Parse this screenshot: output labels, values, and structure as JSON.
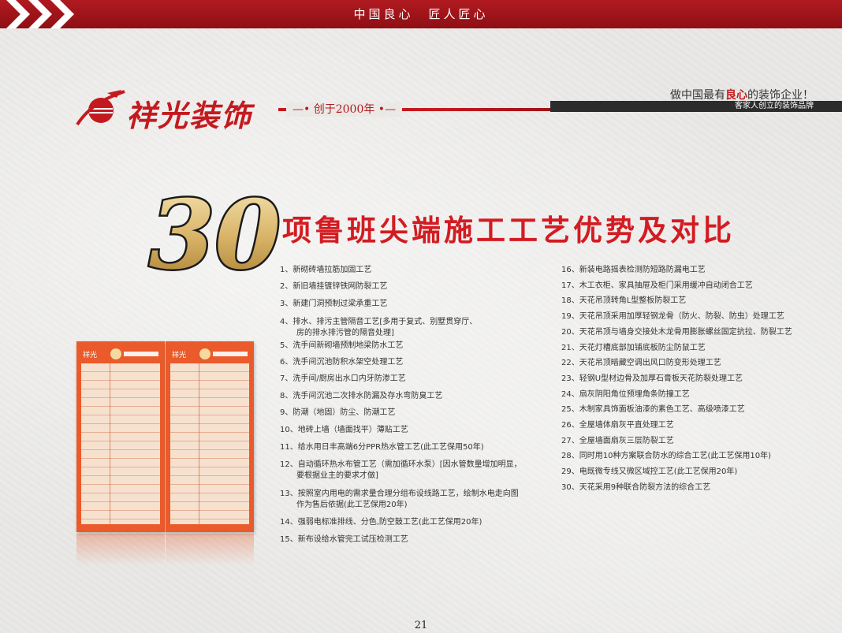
{
  "header": {
    "slogan_bar": "中国良心　匠人匠心"
  },
  "brand": {
    "name": "祥光装饰",
    "founded": "创于2000年",
    "slogan_pre": "做中国最有",
    "slogan_bold": "良心",
    "slogan_post": "的装饰企业！",
    "tagline": "客家人创立的装饰品牌"
  },
  "title": {
    "number": "30",
    "text": "项鲁班尖端施工工艺优势及对比"
  },
  "left_list": [
    {
      "line1": "1、新砌砖墙拉筋加固工艺"
    },
    {
      "line1": "2、新旧墙挂镀锌铁网防裂工艺"
    },
    {
      "line1": "3、新建门洞预制过梁承重工艺"
    },
    {
      "line1": "4、排水、排污主管隔音工艺[多用于复式、别墅贯穿厅、",
      "line2": "房的排水排污管的隔音处理]"
    },
    {
      "line1": "5、洗手间新砌墙预制地梁防水工艺"
    },
    {
      "line1": "6、洗手间沉池防积水架空处理工艺"
    },
    {
      "line1": "7、洗手间/厨房出水口内牙防渗工艺"
    },
    {
      "line1": "8、洗手间沉池二次排水防漏及存水弯防臭工艺"
    },
    {
      "line1": "9、防潮（地固）防尘、防潮工艺"
    },
    {
      "line1": "10、地砖上墙（墙面找平）薄贴工艺"
    },
    {
      "line1": "11、给水用日丰高端6分PPR热水管工艺(此工艺保用50年)"
    },
    {
      "line1": "12、自动循环热水布管工艺（需加循环水泵）[因水管数量增加明显，",
      "line2": "要根据业主的要求才做]"
    },
    {
      "line1": "13、按照室内用电的需求量合理分组布设线路工艺，绘制水电走向图",
      "line2": "作为售后依据(此工艺保用20年)"
    },
    {
      "line1": "14、强弱电标准排线、分色,防空鼓工艺(此工艺保用20年)"
    },
    {
      "line1": "15、新布设给水管完工试压检测工艺"
    }
  ],
  "right_list": [
    "16、新装电路摇表检测防短路防漏电工艺",
    "17、木工衣柜、家具抽屉及柜门采用缓冲自动闭合工艺",
    "18、天花吊顶转角L型整板防裂工艺",
    "19、天花吊顶采用加厚轻钢龙骨（防火、防裂、防虫）处理工艺",
    "20、天花吊顶与墙身交接处木龙骨用膨胀螺丝固定抗拉、防裂工艺",
    "21、天花灯槽底部加铺底板防尘防鼠工艺",
    "22、天花吊顶暗藏空调出风口防变形处理工艺",
    "23、轻钢U型材边骨及加厚石膏板天花防裂处理工艺",
    "24、扇灰阴阳角位预埋角条防撞工艺",
    "25、木制家具饰面板油漆的素色工艺、高级喷漆工艺",
    "26、全屋墙体扇灰平直处理工艺",
    "27、全屋墙面扇灰三层防裂工艺",
    "28、同时用10种方案联合防水的综合工艺(此工艺保用10年)",
    "29、电既微专线又微区域控工艺(此工艺保用20年)",
    "30、天花采用9种联合防裂方法的综合工艺"
  ],
  "page_number": "21",
  "colors": {
    "brand_red": "#c41a1f",
    "poster_orange": "#ea5a2a",
    "dark_bar": "#2c2c2c"
  }
}
